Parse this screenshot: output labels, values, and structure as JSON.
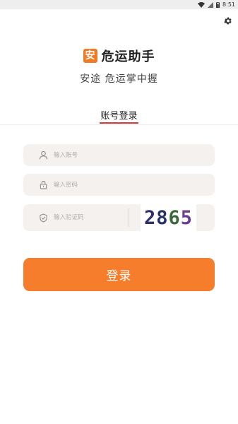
{
  "status_bar": {
    "time": "8:51"
  },
  "app": {
    "logo_char": "安",
    "name": "危运助手",
    "slogan": "安途   危运掌中握"
  },
  "tab": {
    "label": "账号登录"
  },
  "form": {
    "account_placeholder": "输入账号",
    "password_placeholder": "输入密码",
    "captcha_placeholder": "输入验证码",
    "captcha_code": "2865",
    "captcha_digit_colors": [
      "#2a2f6e",
      "#26306a",
      "#3b6a3a",
      "#6d3e8e"
    ]
  },
  "login_button": {
    "label": "登录"
  },
  "colors": {
    "accent": "#f57d2c",
    "tab_underline": "#cf3a3a",
    "field_bg": "#f4f1ee"
  }
}
